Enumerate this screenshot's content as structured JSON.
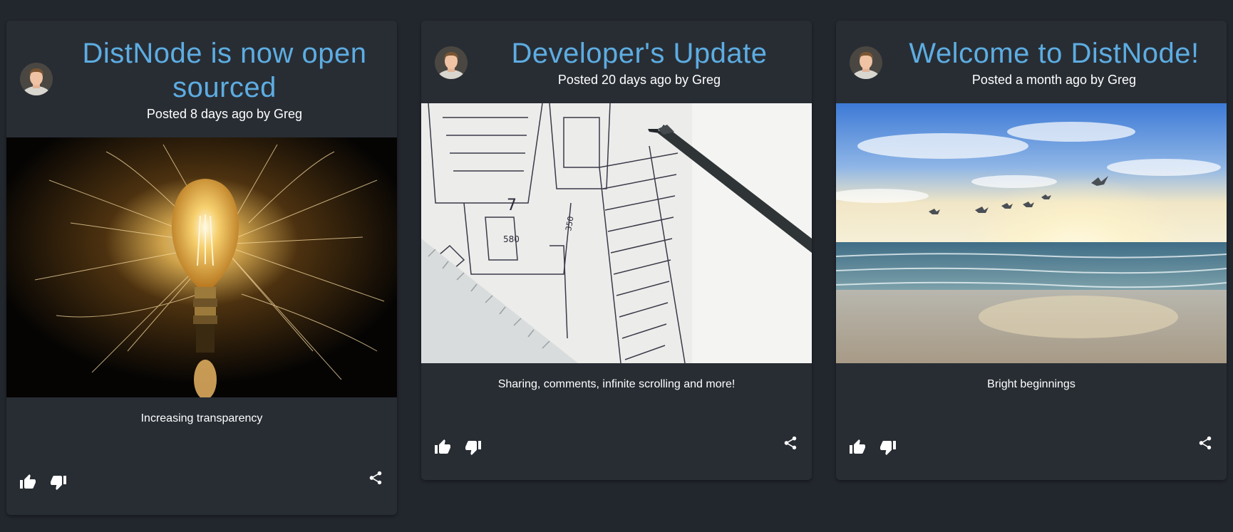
{
  "author": "Greg",
  "colors": {
    "background": "#22262d",
    "card": "#282d34",
    "title": "#5dade2",
    "text": "#ffffff"
  },
  "posts": [
    {
      "title": "DistNode is now open sourced",
      "meta": "Posted 8 days ago by Greg",
      "caption": "Increasing transparency",
      "image_subject": "light-bulb-with-sparks",
      "avatar_icon": "author-avatar",
      "actions": [
        "thumbs-up-icon",
        "thumbs-down-icon",
        "share-icon"
      ]
    },
    {
      "title": "Developer's Update",
      "meta": "Posted 20 days ago by Greg",
      "caption": "Sharing, comments, infinite scrolling and more!",
      "image_subject": "architectural-blueprint-with-pen",
      "avatar_icon": "author-avatar",
      "actions": [
        "thumbs-up-icon",
        "thumbs-down-icon",
        "share-icon"
      ]
    },
    {
      "title": "Welcome to DistNode!",
      "meta": "Posted a month ago by Greg",
      "caption": "Bright beginnings",
      "image_subject": "beach-sunrise-with-seagulls",
      "avatar_icon": "author-avatar",
      "actions": [
        "thumbs-up-icon",
        "thumbs-down-icon",
        "share-icon"
      ]
    }
  ]
}
